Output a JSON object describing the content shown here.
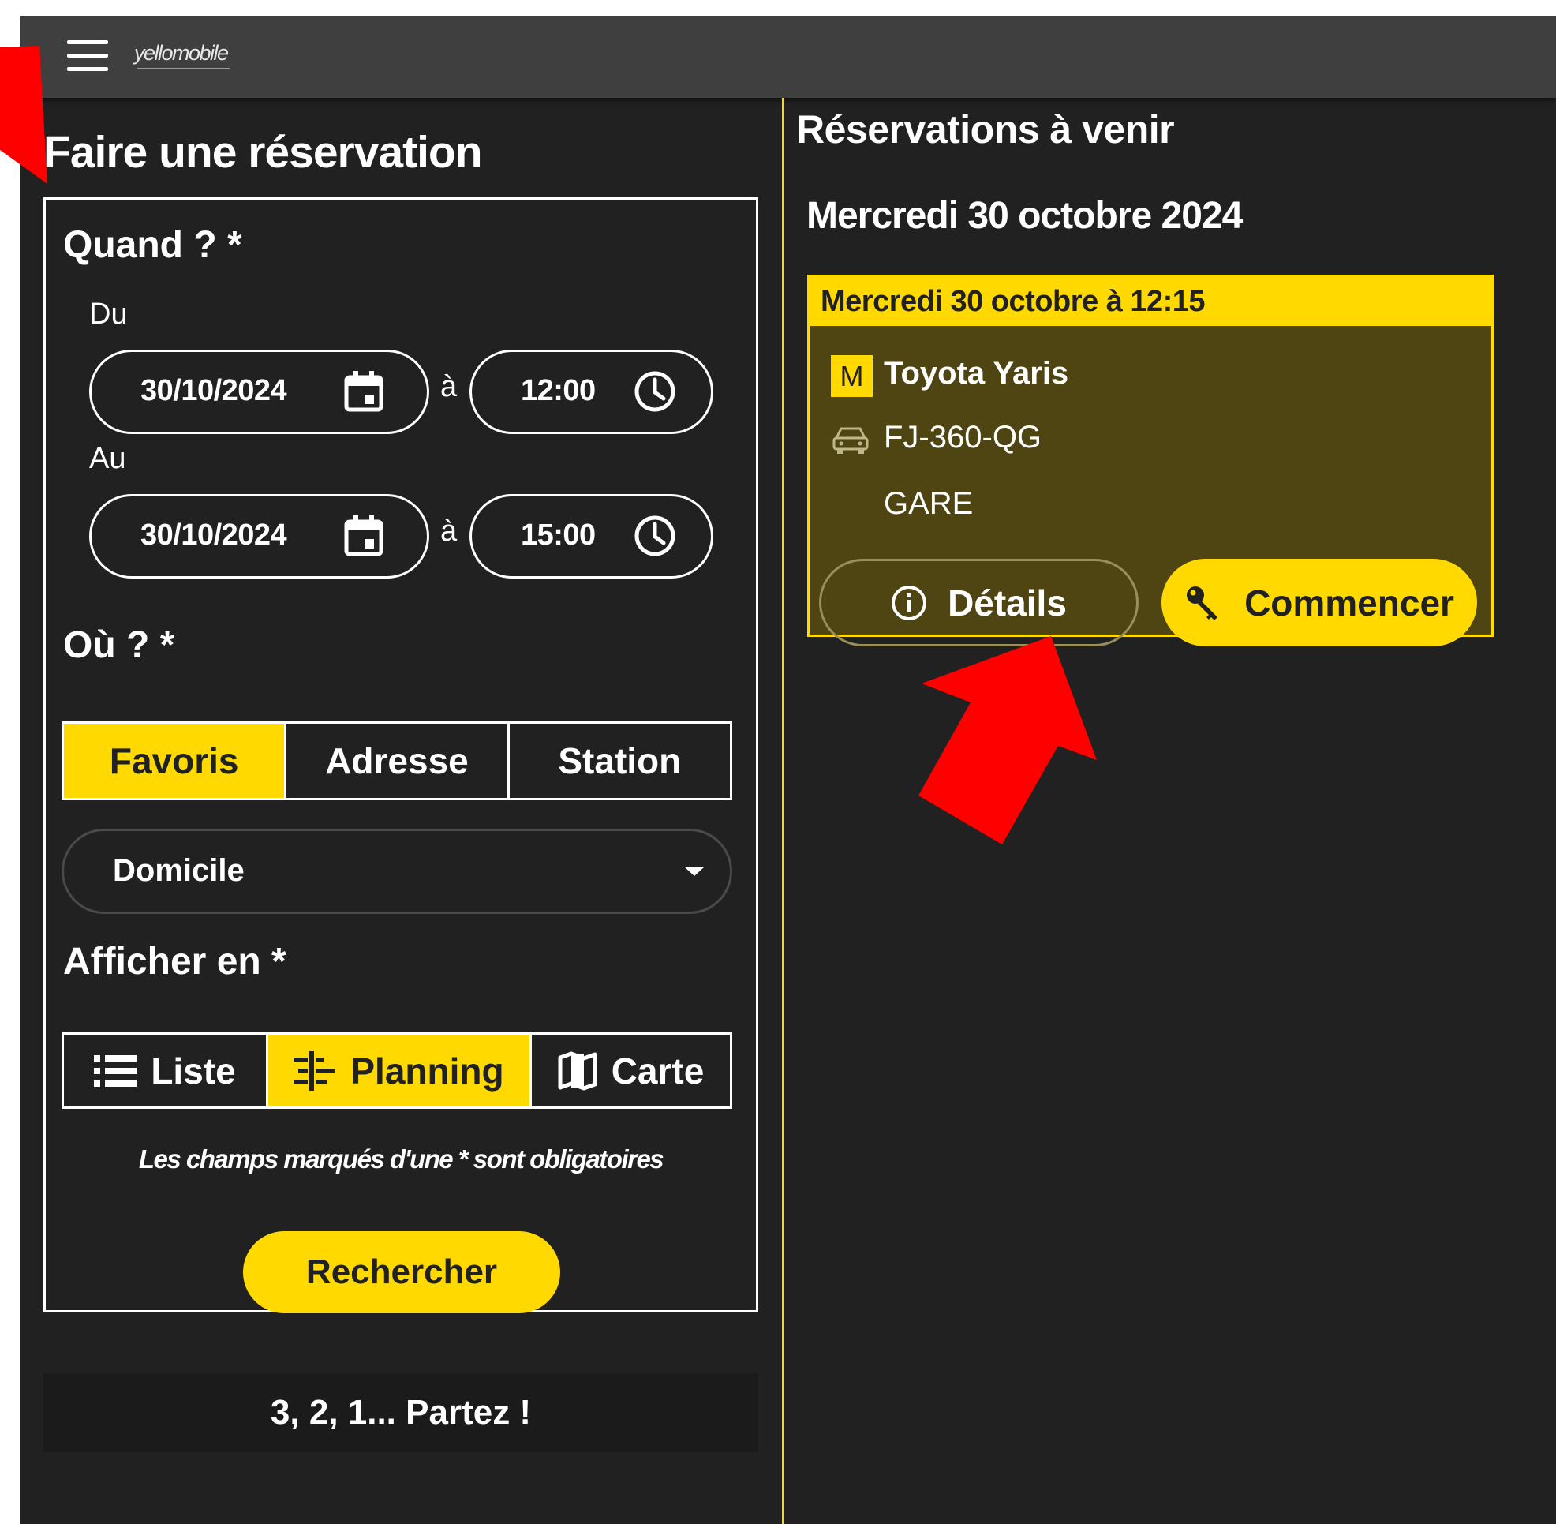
{
  "header": {
    "logo_text": "yellomobile",
    "menu_icon": "hamburger-menu-icon"
  },
  "booking_form": {
    "title": "Faire une réservation",
    "when": {
      "label": "Quand ? *",
      "from_label": "Du",
      "from_date": "30/10/2024",
      "from_time": "12:00",
      "to_label": "Au",
      "to_date": "30/10/2024",
      "to_time": "15:00",
      "time_separator": "à"
    },
    "where": {
      "label": "Où ? *",
      "tabs": [
        {
          "label": "Favoris",
          "active": true
        },
        {
          "label": "Adresse",
          "active": false
        },
        {
          "label": "Station",
          "active": false
        }
      ],
      "selected_favorite": "Domicile"
    },
    "display": {
      "label": "Afficher en *",
      "options": [
        {
          "label": "Liste",
          "icon": "list-icon",
          "active": false
        },
        {
          "label": "Planning",
          "icon": "planning-icon",
          "active": true
        },
        {
          "label": "Carte",
          "icon": "map-icon",
          "active": false
        }
      ]
    },
    "required_note": "Les champs marqués d'une * sont obligatoires",
    "search_button": "Rechercher"
  },
  "footer_banner": "3, 2, 1... Partez !",
  "upcoming": {
    "title": "Réservations à venir",
    "date_heading": "Mercredi 30 octobre 2024",
    "reservation": {
      "header": "Mercredi 30 octobre à 12:15",
      "badge": "M",
      "car_model": "Toyota Yaris",
      "plate": "FJ-360-QG",
      "station": "GARE",
      "details_button": "Détails",
      "start_button": "Commencer"
    }
  },
  "colors": {
    "accent": "#ffd900",
    "background": "#212121",
    "topbar": "#3f3f3f",
    "card_body": "#4f4513",
    "annotation_arrow": "#ff0000"
  }
}
